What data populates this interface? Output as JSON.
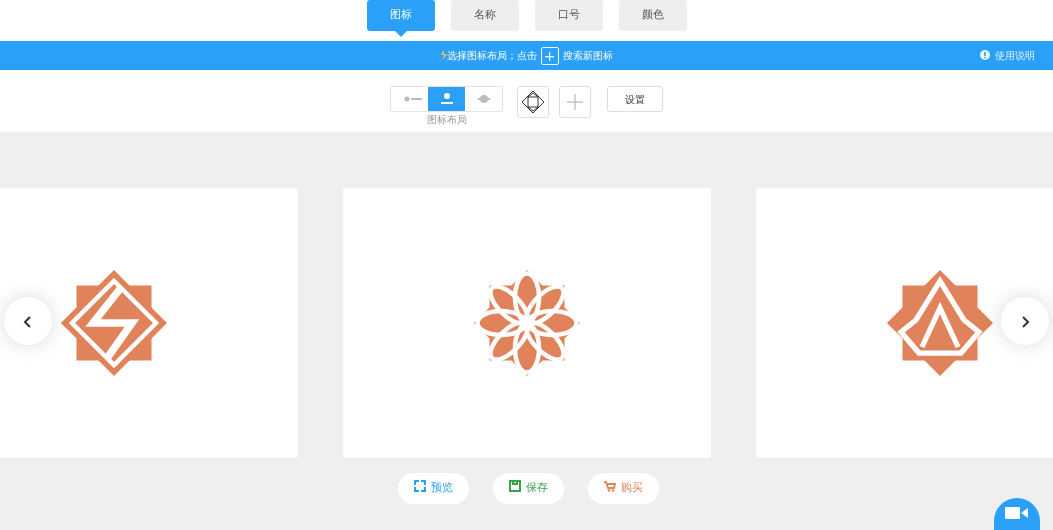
{
  "tabs": [
    {
      "label": "图标",
      "selected": true
    },
    {
      "label": "名称",
      "selected": false
    },
    {
      "label": "口号",
      "selected": false
    },
    {
      "label": "颜色",
      "selected": false
    }
  ],
  "banner": {
    "text_before": "选择图标布局；点击",
    "button": "+",
    "text_after": "搜索新图标",
    "help": "使用说明"
  },
  "layout": {
    "options": [
      {
        "kind": "left",
        "selected": false
      },
      {
        "kind": "top",
        "selected": true
      },
      {
        "kind": "behind",
        "selected": false
      }
    ],
    "caption": "图标布局"
  },
  "settings_button": "设置",
  "cards": [
    {
      "kind": "bolt"
    },
    {
      "kind": "flower"
    },
    {
      "kind": "flame"
    }
  ],
  "actions": [
    {
      "kind": "preview",
      "label": "预览",
      "color": "#2aa0f0"
    },
    {
      "kind": "save",
      "label": "保存",
      "color": "#3aa04a"
    },
    {
      "kind": "buy",
      "label": "购买",
      "color": "#e0835a"
    }
  ]
}
